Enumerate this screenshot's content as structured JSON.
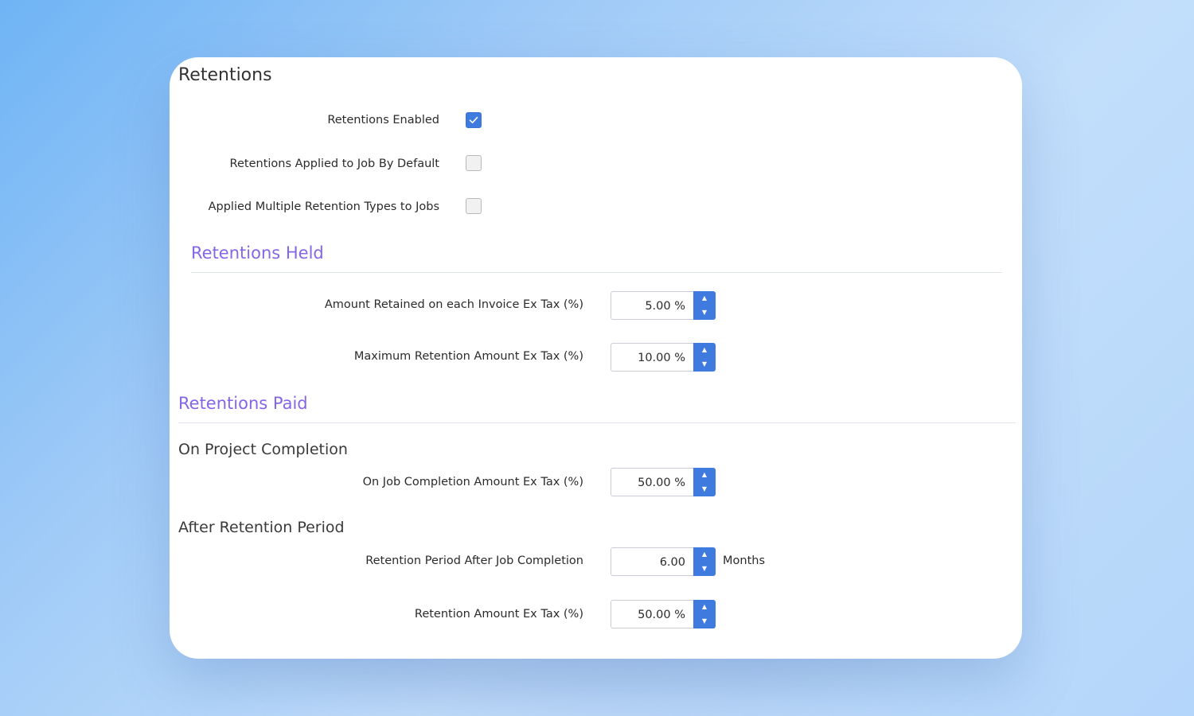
{
  "card": {
    "title": "Retentions"
  },
  "settings": [
    {
      "label": "Retentions Enabled",
      "checked": true
    },
    {
      "label": "Retentions Applied to Job By Default",
      "checked": false
    },
    {
      "label": "Applied Multiple Retention Types to Jobs",
      "checked": false
    }
  ],
  "held": {
    "title": "Retentions Held",
    "fields": [
      {
        "label": "Amount Retained on each Invoice Ex Tax (%)",
        "value": "5.00 %"
      },
      {
        "label": "Maximum Retention Amount Ex Tax (%)",
        "value": "10.00 %"
      }
    ]
  },
  "paid": {
    "title": "Retentions Paid",
    "on_completion": {
      "title": "On Project Completion",
      "field": {
        "label": "On Job Completion Amount Ex Tax (%)",
        "value": "50.00 %"
      }
    },
    "after_period": {
      "title": "After Retention Period",
      "period": {
        "label": "Retention Period After Job Completion",
        "value": "6.00",
        "suffix": "Months"
      },
      "amount": {
        "label": "Retention Amount Ex Tax (%)",
        "value": "50.00 %"
      }
    }
  },
  "colors": {
    "accent": "#3f7bde",
    "section": "#8565e8"
  },
  "icons": {
    "check": "check-icon",
    "up": "chevron-up-icon",
    "down": "chevron-down-icon"
  }
}
